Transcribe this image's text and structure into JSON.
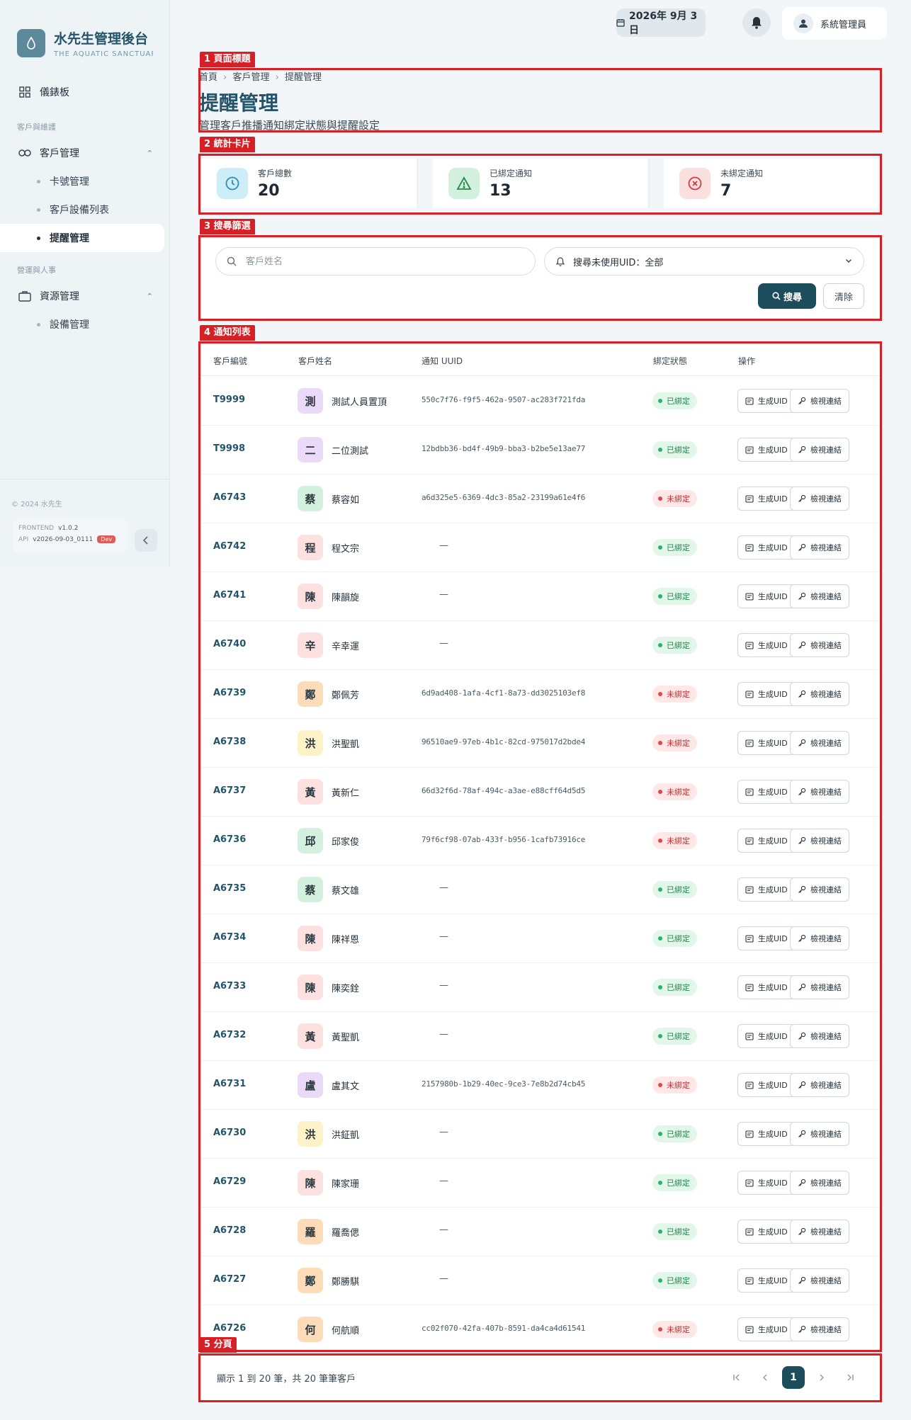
{
  "brand": {
    "title": "水先生管理後台",
    "subtitle": "THE AQUATIC SANCTUARY"
  },
  "nav": {
    "dashboard": "儀錶板",
    "section_customers": "客戶與維護",
    "customer_mgmt": "客戶管理",
    "sub_card": "卡號管理",
    "sub_devices": "客戶設備列表",
    "sub_reminders": "提醒管理",
    "section_ops": "營運與人事",
    "resource_mgmt": "資源管理",
    "sub_equipment": "設備管理"
  },
  "footer": {
    "copyright": "© 2024 水先生",
    "frontend_key": "FRONTEND",
    "frontend_val": "v1.0.2",
    "api_key": "API",
    "api_val": "v2026-09-03_0111",
    "env": "Dev"
  },
  "topbar": {
    "date": "2026年 9月 3日",
    "user": "系統管理員"
  },
  "annotations": {
    "a1": "1 頁面標題",
    "a2": "2 統計卡片",
    "a3": "3 搜尋篩選",
    "a4": "4 通知列表",
    "a5": "5 分頁"
  },
  "header": {
    "crumb_home": "首頁",
    "crumb_customers": "客戶管理",
    "crumb_current": "提醒管理",
    "title": "提醒管理",
    "desc": "管理客戶推播通知綁定狀態與提醒設定"
  },
  "stats": [
    {
      "label": "客戶總數",
      "value": "20",
      "icon": "clock-icon",
      "color": "#2b8fb3"
    },
    {
      "label": "已綁定通知",
      "value": "13",
      "icon": "alert-triangle-icon",
      "color": "#1f8a4c"
    },
    {
      "label": "未綁定通知",
      "value": "7",
      "icon": "x-circle-icon",
      "color": "#d13b3b"
    }
  ],
  "filter": {
    "search_placeholder": "客戶姓名",
    "select_value": "搜尋未使用UID：全部",
    "search_btn": "搜尋",
    "clear_btn": "清除"
  },
  "table": {
    "headers": [
      "客戶編號",
      "客戶姓名",
      "通知 UUID",
      "綁定狀態",
      "操作"
    ],
    "action_generate": "生成UID",
    "action_view": "檢視連結",
    "status_bound": "已綁定",
    "status_unbound": "未綁定",
    "rows": [
      {
        "id": "T9999",
        "initial": "測",
        "name": "測試人員置頂",
        "uuid": "550c7f76-f9f5-462a-9507-ac283f721fda",
        "bound": true,
        "avatar_color": "#ead9f7"
      },
      {
        "id": "T9998",
        "initial": "二",
        "name": "二位測試",
        "uuid": "12bdbb36-bd4f-49b9-bba3-b2be5e13ae77",
        "bound": true,
        "avatar_color": "#ead9f7"
      },
      {
        "id": "A6743",
        "initial": "蔡",
        "name": "蔡容如",
        "uuid": "a6d325e5-6369-4dc3-85a2-23199a61e4f6",
        "bound": false,
        "avatar_color": "#d4f0df"
      },
      {
        "id": "A6742",
        "initial": "程",
        "name": "程文宗",
        "uuid": "—",
        "bound": true,
        "avatar_color": "#fde0e0"
      },
      {
        "id": "A6741",
        "initial": "陳",
        "name": "陳韻旋",
        "uuid": "—",
        "bound": true,
        "avatar_color": "#fde0e0"
      },
      {
        "id": "A6740",
        "initial": "辛",
        "name": "辛幸運",
        "uuid": "—",
        "bound": true,
        "avatar_color": "#fde0e0"
      },
      {
        "id": "A6739",
        "initial": "鄭",
        "name": "鄭佩芳",
        "uuid": "6d9ad408-1afa-4cf1-8a73-dd3025103ef8",
        "bound": false,
        "avatar_color": "#fcdcb8"
      },
      {
        "id": "A6738",
        "initial": "洪",
        "name": "洪聖凱",
        "uuid": "96510ae9-97eb-4b1c-82cd-975017d2bde4",
        "bound": false,
        "avatar_color": "#fdf1c7"
      },
      {
        "id": "A6737",
        "initial": "黃",
        "name": "黃新仁",
        "uuid": "66d32f6d-78af-494c-a3ae-e88cff64d5d5",
        "bound": false,
        "avatar_color": "#fde0e0"
      },
      {
        "id": "A6736",
        "initial": "邱",
        "name": "邱家俊",
        "uuid": "79f6cf98-07ab-433f-b956-1cafb73916ce",
        "bound": false,
        "avatar_color": "#d4f0df"
      },
      {
        "id": "A6735",
        "initial": "蔡",
        "name": "蔡文雄",
        "uuid": "—",
        "bound": true,
        "avatar_color": "#d4f0df"
      },
      {
        "id": "A6734",
        "initial": "陳",
        "name": "陳祥恩",
        "uuid": "—",
        "bound": true,
        "avatar_color": "#fde0e0"
      },
      {
        "id": "A6733",
        "initial": "陳",
        "name": "陳奕銓",
        "uuid": "—",
        "bound": true,
        "avatar_color": "#fde0e0"
      },
      {
        "id": "A6732",
        "initial": "黃",
        "name": "黃聖凱",
        "uuid": "—",
        "bound": true,
        "avatar_color": "#fde0e0"
      },
      {
        "id": "A6731",
        "initial": "盧",
        "name": "盧其文",
        "uuid": "2157980b-1b29-40ec-9ce3-7e8b2d74cb45",
        "bound": false,
        "avatar_color": "#ead9f7"
      },
      {
        "id": "A6730",
        "initial": "洪",
        "name": "洪鉦凱",
        "uuid": "—",
        "bound": true,
        "avatar_color": "#fdf1c7"
      },
      {
        "id": "A6729",
        "initial": "陳",
        "name": "陳家珊",
        "uuid": "—",
        "bound": true,
        "avatar_color": "#fde0e0"
      },
      {
        "id": "A6728",
        "initial": "羅",
        "name": "羅喬偲",
        "uuid": "—",
        "bound": true,
        "avatar_color": "#fcdcb8"
      },
      {
        "id": "A6727",
        "initial": "鄭",
        "name": "鄭勝騏",
        "uuid": "—",
        "bound": true,
        "avatar_color": "#fcdcb8"
      },
      {
        "id": "A6726",
        "initial": "何",
        "name": "何航順",
        "uuid": "cc02f070-42fa-407b-8591-da4ca4d61541",
        "bound": false,
        "avatar_color": "#fcdcb8"
      }
    ]
  },
  "pagination": {
    "info": "顯示 1 到 20 筆，共 20 筆筆客戶",
    "current": "1"
  }
}
